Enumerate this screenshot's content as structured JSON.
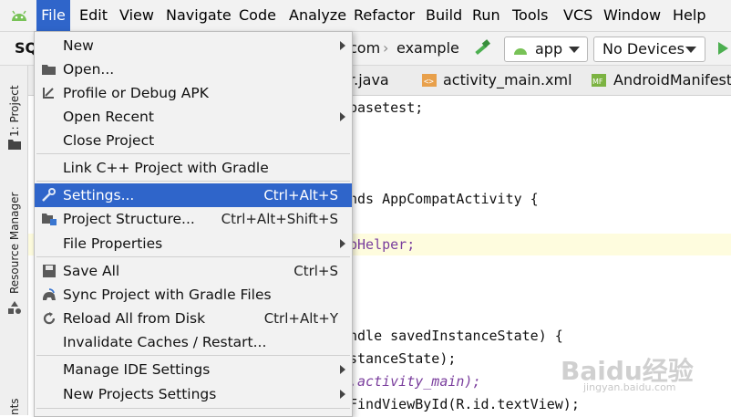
{
  "menubar": {
    "items": [
      {
        "label": "File",
        "active": true
      },
      {
        "label": "Edit"
      },
      {
        "label": "View"
      },
      {
        "label": "Navigate"
      },
      {
        "label": "Code"
      },
      {
        "label": "Analyze"
      },
      {
        "label": "Refactor"
      },
      {
        "label": "Build"
      },
      {
        "label": "Run"
      },
      {
        "label": "Tools"
      },
      {
        "label": "VCS"
      },
      {
        "label": "Window"
      },
      {
        "label": "Help"
      }
    ]
  },
  "toolbar": {
    "project_short": "SQ",
    "breadcrumb_1": "com",
    "breadcrumb_2": "example",
    "run_config": "app",
    "device": "No Devices"
  },
  "tabs": [
    {
      "label": "r.java"
    },
    {
      "label": "activity_main.xml"
    },
    {
      "label": "AndroidManifest.x"
    }
  ],
  "side": {
    "project_label": "1: Project",
    "resource_label": "Resource Manager",
    "bottom_label": "nts"
  },
  "code_lines": [
    "basetest;",
    "nds AppCompatActivity {",
    "bHelper;",
    "ndle savedInstanceState) {",
    "stanceState);",
    ".activity_main);",
    "FindViewById(R.id.textView);"
  ],
  "file_menu": {
    "items": [
      {
        "label": "New",
        "submenu": true
      },
      {
        "label": "Open...",
        "icon": "folder-open-icon"
      },
      {
        "label": "Profile or Debug APK",
        "icon": "profile-apk-icon"
      },
      {
        "label": "Open Recent",
        "submenu": true
      },
      {
        "label": "Close Project"
      },
      {
        "label": "Link C++ Project with Gradle"
      },
      {
        "label": "Settings...",
        "shortcut": "Ctrl+Alt+S",
        "selected": true,
        "icon": "wrench-icon"
      },
      {
        "label": "Project Structure...",
        "shortcut": "Ctrl+Alt+Shift+S",
        "icon": "project-structure-icon"
      },
      {
        "label": "File Properties",
        "submenu": true
      },
      {
        "label": "Save All",
        "shortcut": "Ctrl+S",
        "icon": "save-icon"
      },
      {
        "label": "Sync Project with Gradle Files",
        "icon": "gradle-sync-icon"
      },
      {
        "label": "Reload All from Disk",
        "shortcut": "Ctrl+Alt+Y",
        "icon": "reload-icon"
      },
      {
        "label": "Invalidate Caches / Restart..."
      },
      {
        "label": "Manage IDE Settings",
        "submenu": true
      },
      {
        "label": "New Projects Settings",
        "submenu": true
      }
    ]
  },
  "watermark": {
    "text": "Baidu经验",
    "sub": "jingyan.baidu.com"
  },
  "colors": {
    "selection": "#2f65ca",
    "menu_bg": "#f2f2f2",
    "highlight_line": "#fefcde"
  }
}
